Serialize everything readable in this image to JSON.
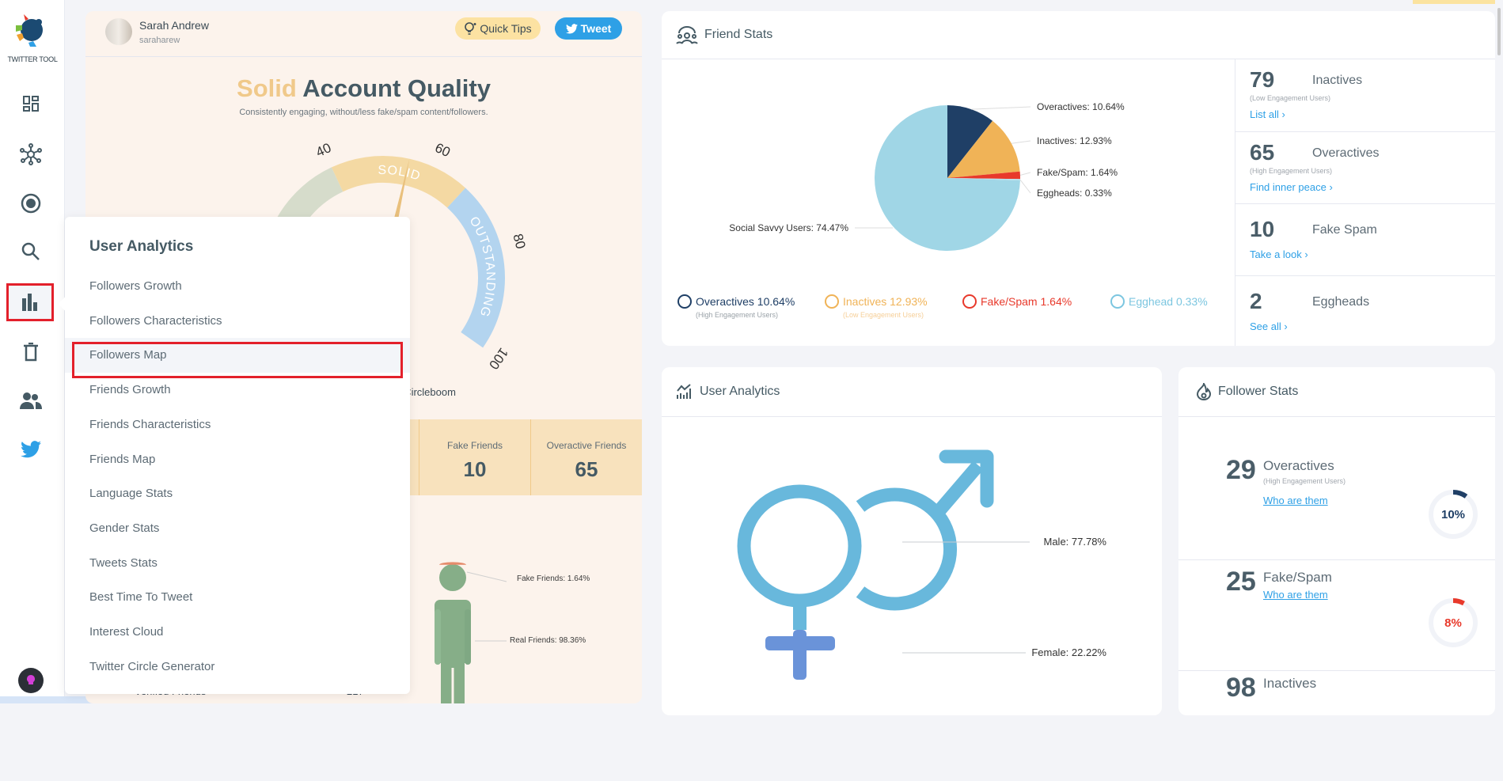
{
  "app": {
    "logo_text": "TWITTER TOOL"
  },
  "sidebar": {
    "items": [
      {
        "icon": "dashboard-icon"
      },
      {
        "icon": "network-icon"
      },
      {
        "icon": "target-icon"
      },
      {
        "icon": "search-icon"
      },
      {
        "icon": "bar-chart-icon",
        "active": true
      },
      {
        "icon": "trash-icon"
      },
      {
        "icon": "users-icon"
      },
      {
        "icon": "twitter-bird-icon"
      }
    ]
  },
  "profile": {
    "name": "Sarah Andrew",
    "handle": "saraharew"
  },
  "buttons": {
    "quick_tips": "Quick Tips",
    "tweet": "Tweet"
  },
  "quality": {
    "level": "Solid",
    "title_rest": " Account Quality",
    "subtitle": "Consistently engaging, without/less fake/spam content/followers.",
    "score": 55,
    "ticks": [
      "40",
      "60",
      "80",
      "100"
    ],
    "band_solid": "SOLID",
    "band_outstanding": "OUTSTANDING",
    "credit": "d by Circleboom",
    "colors": {
      "low": "#d6dccb",
      "solid": "#f4d9a3",
      "outstanding": "#b3d4ef",
      "level_text": "#f0c98a"
    }
  },
  "friend_counts": [
    {
      "label": "Fake Friends",
      "value": "10"
    },
    {
      "label": "Overactive Friends",
      "value": "65"
    }
  ],
  "figure": {
    "fake_label": "Fake Friends: 1.64%",
    "real_label": "Real Friends: 98.36%",
    "fake_pct": 1.64,
    "real_pct": 98.36
  },
  "verified": {
    "label": "Verified Friends",
    "value": "217"
  },
  "menu": {
    "title": "User Analytics",
    "items": [
      "Followers Growth",
      "Followers Characteristics",
      "Followers Map",
      "Friends Growth",
      "Friends Characteristics",
      "Friends Map",
      "Language Stats",
      "Gender Stats",
      "Tweets Stats",
      "Best Time To Tweet",
      "Interest Cloud",
      "Twitter Circle Generator"
    ],
    "highlighted": "Followers Map"
  },
  "friend_stats": {
    "title": "Friend Stats",
    "legend": [
      {
        "label": "Overactives 10.64%",
        "sub": "(High Engagement Users)",
        "color": "#1f3f66",
        "icon": "head-gear-icon"
      },
      {
        "label": "Inactives 12.93%",
        "sub": "(Low Engagement Users)",
        "color": "#f0b357",
        "icon": "sad-face-icon"
      },
      {
        "label": "Fake/Spam 1.64%",
        "sub": "",
        "color": "#e8392b",
        "icon": "angry-face-icon"
      },
      {
        "label": "Egghead 0.33%",
        "sub": "",
        "color": "#7cc6e0",
        "icon": "egg-icon"
      }
    ],
    "side": [
      {
        "value": "79",
        "label": "Inactives",
        "sub": "(Low Engagement Users)",
        "link": "List all ›"
      },
      {
        "value": "65",
        "label": "Overactives",
        "sub": "(High Engagement Users)",
        "link": "Find inner peace ›"
      },
      {
        "value": "10",
        "label": "Fake Spam",
        "sub": "",
        "link": "Take a look ›"
      },
      {
        "value": "2",
        "label": "Eggheads",
        "sub": "",
        "link": "See all ›"
      }
    ]
  },
  "user_analytics": {
    "title": "User Analytics"
  },
  "follower_stats": {
    "title": "Follower Stats",
    "rows": [
      {
        "value": "29",
        "label": "Overactives",
        "sub": "(High Engagement Users)",
        "link": "Who are them",
        "pct": 10,
        "pct_label": "10%",
        "color": "#1f3f66"
      },
      {
        "value": "25",
        "label": "Fake/Spam",
        "sub": "",
        "link": "Who are them",
        "pct": 8,
        "pct_label": "8%",
        "color": "#e8392b"
      },
      {
        "value": "98",
        "label": "Inactives",
        "sub": "",
        "link": "",
        "pct": null,
        "pct_label": "",
        "color": "#f0b357"
      }
    ]
  },
  "chart_data": [
    {
      "type": "pie",
      "slices": [
        {
          "label": "Overactives",
          "value": 10.64,
          "text": "Overactives: 10.64%",
          "color": "#1f3f66"
        },
        {
          "label": "Inactives",
          "value": 12.93,
          "text": "Inactives: 12.93%",
          "color": "#f0b357"
        },
        {
          "label": "Fake/Spam",
          "value": 1.64,
          "text": "Fake/Spam: 1.64%",
          "color": "#e8392b"
        },
        {
          "label": "Eggheads",
          "value": 0.33,
          "text": "Eggheads: 0.33%",
          "color": "#b7e0ec"
        },
        {
          "label": "Social Savvy Users",
          "value": 74.47,
          "text": "Social Savvy Users: 74.47%",
          "color": "#a0d6e6"
        }
      ]
    },
    {
      "type": "pie",
      "categories": [
        "Male",
        "Female"
      ],
      "values": [
        77.78,
        22.22
      ],
      "labels": [
        "Male: 77.78%",
        "Female: 22.22%"
      ],
      "colors": [
        "#68b8dc",
        "#6a93d9"
      ]
    }
  ]
}
